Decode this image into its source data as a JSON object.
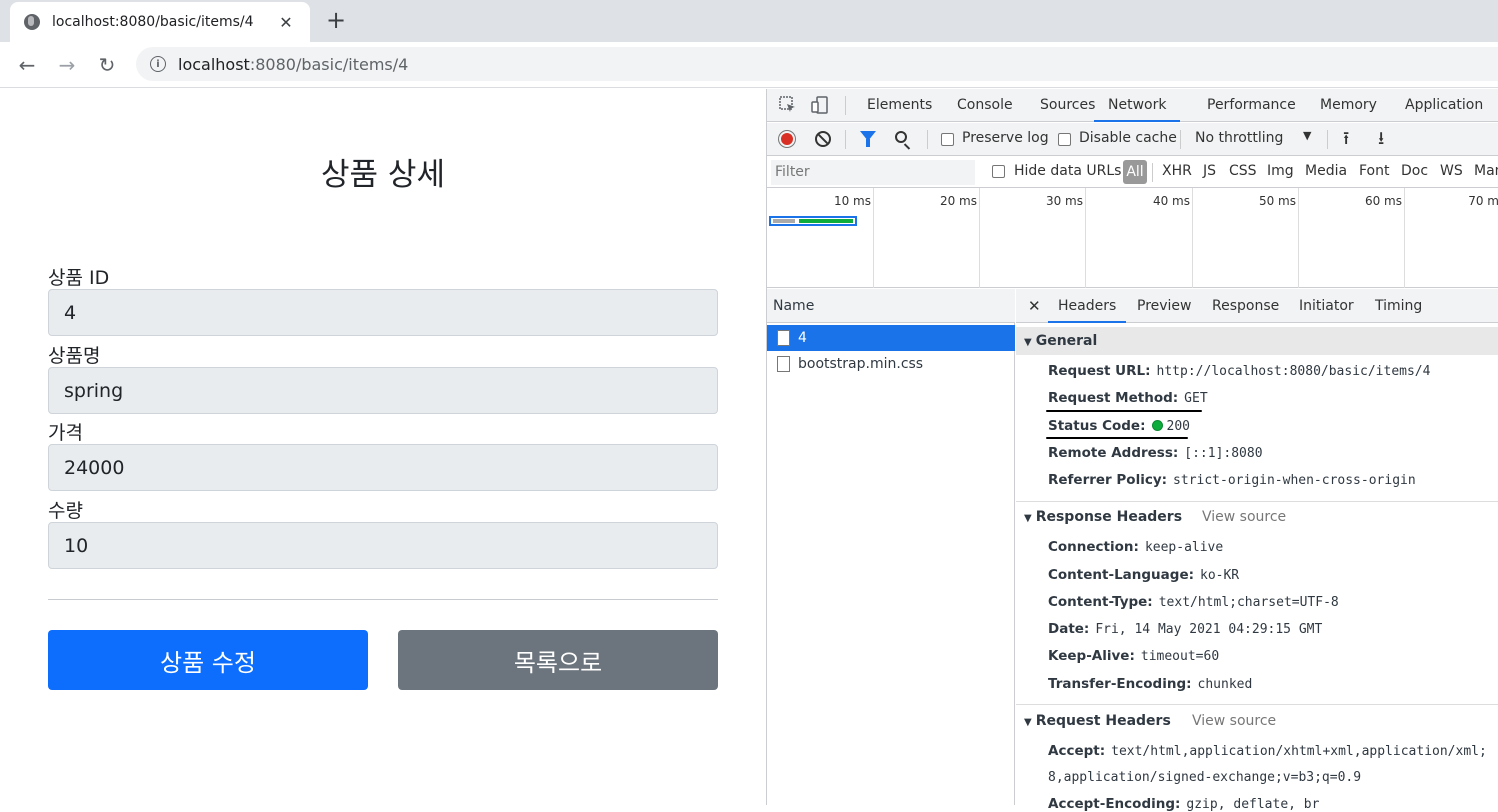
{
  "browser": {
    "tab_title": "localhost:8080/basic/items/4",
    "url_host": "localhost",
    "url_path": ":8080/basic/items/4"
  },
  "page": {
    "title": "상품 상세",
    "fields": [
      {
        "label": "상품 ID",
        "value": "4"
      },
      {
        "label": "상품명",
        "value": "spring"
      },
      {
        "label": "가격",
        "value": "24000"
      },
      {
        "label": "수량",
        "value": "10"
      }
    ],
    "edit_button": "상품 수정",
    "list_button": "목록으로"
  },
  "devtools": {
    "tabs": [
      "Elements",
      "Console",
      "Sources",
      "Network",
      "Performance",
      "Memory",
      "Application"
    ],
    "active_tab": "Network",
    "preserve_log": "Preserve log",
    "disable_cache": "Disable cache",
    "throttling": "No throttling",
    "filter_placeholder": "Filter",
    "hide_data_urls": "Hide data URLs",
    "type_filters": [
      "All",
      "XHR",
      "JS",
      "CSS",
      "Img",
      "Media",
      "Font",
      "Doc",
      "WS",
      "Man"
    ],
    "timeline_ticks": [
      "10 ms",
      "20 ms",
      "30 ms",
      "40 ms",
      "50 ms",
      "60 ms",
      "70 m"
    ],
    "names_header": "Name",
    "requests": [
      "4",
      "bootstrap.min.css"
    ],
    "detail_tabs": [
      "Headers",
      "Preview",
      "Response",
      "Initiator",
      "Timing"
    ],
    "general": {
      "title": "General",
      "request_url_k": "Request URL:",
      "request_url_v": "http://localhost:8080/basic/items/4",
      "method_k": "Request Method:",
      "method_v": "GET",
      "status_k": "Status Code:",
      "status_v": "200",
      "remote_k": "Remote Address:",
      "remote_v": "[::1]:8080",
      "referrer_k": "Referrer Policy:",
      "referrer_v": "strict-origin-when-cross-origin"
    },
    "response_headers": {
      "title": "Response Headers",
      "view_source": "View source",
      "connection_k": "Connection:",
      "connection_v": "keep-alive",
      "lang_k": "Content-Language:",
      "lang_v": "ko-KR",
      "type_k": "Content-Type:",
      "type_v": "text/html;charset=UTF-8",
      "date_k": "Date:",
      "date_v": "Fri, 14 May 2021 04:29:15 GMT",
      "keepalive_k": "Keep-Alive:",
      "keepalive_v": "timeout=60",
      "te_k": "Transfer-Encoding:",
      "te_v": "chunked"
    },
    "request_headers": {
      "title": "Request Headers",
      "view_source": "View source",
      "accept_k": "Accept:",
      "accept_v": "text/html,application/xhtml+xml,application/xml;",
      "accept_v2": "8,application/signed-exchange;v=b3;q=0.9",
      "enc_k": "Accept-Encoding:",
      "enc_v": "gzip, deflate, br"
    }
  },
  "colors": {
    "primary": "#0d6efd",
    "secondary": "#6c757d",
    "devtools_accent": "#1a73e8",
    "status_ok": "#0dac3d"
  }
}
